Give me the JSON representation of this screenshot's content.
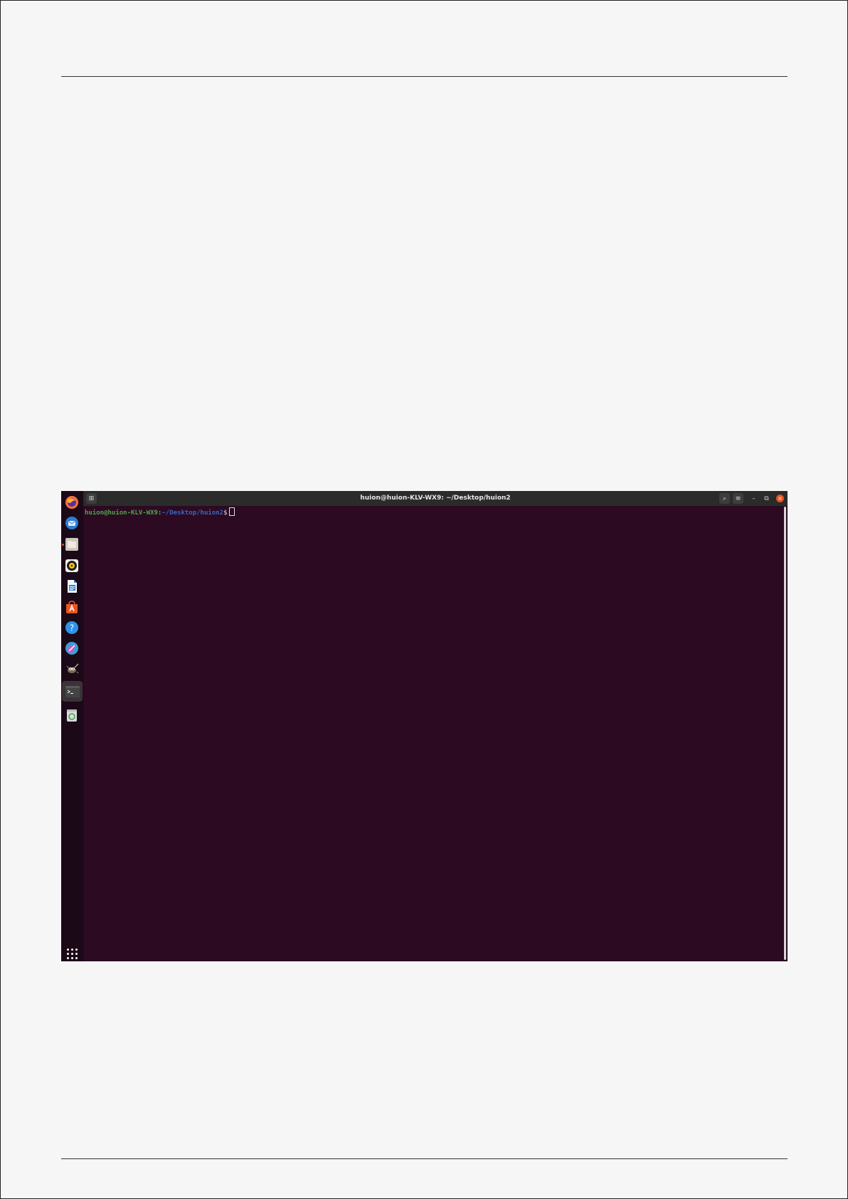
{
  "terminal": {
    "title": "huion@huion-KLV-WX9: ~/Desktop/huion2",
    "prompt_user_host": "huion@huion-KLV-WX9",
    "prompt_colon": ":",
    "prompt_path": "~/Desktop/huion2",
    "prompt_symbol": "$"
  },
  "dock": {
    "items": [
      {
        "name": "firefox-icon",
        "color": "#ff7139"
      },
      {
        "name": "thunderbird-icon",
        "color": "#2a7fd4"
      },
      {
        "name": "files-icon",
        "color": "#d6cfc4"
      },
      {
        "name": "rhythmbox-icon",
        "color": "#f2c80f"
      },
      {
        "name": "libreoffice-writer-icon",
        "color": "#2b7fd4"
      },
      {
        "name": "ubuntu-software-icon",
        "color": "#e95420"
      },
      {
        "name": "help-icon",
        "color": "#2e93e8"
      },
      {
        "name": "krita-icon",
        "color": "#c85bd6"
      },
      {
        "name": "gimp-icon",
        "color": "#7a6a55"
      },
      {
        "name": "terminal-icon",
        "color": "#444444"
      },
      {
        "name": "trash-icon",
        "color": "#d9d9d9"
      }
    ]
  },
  "colors": {
    "terminal_bg": "#2c0a21",
    "dock_bg": "#1b0918",
    "accent": "#e95420"
  }
}
